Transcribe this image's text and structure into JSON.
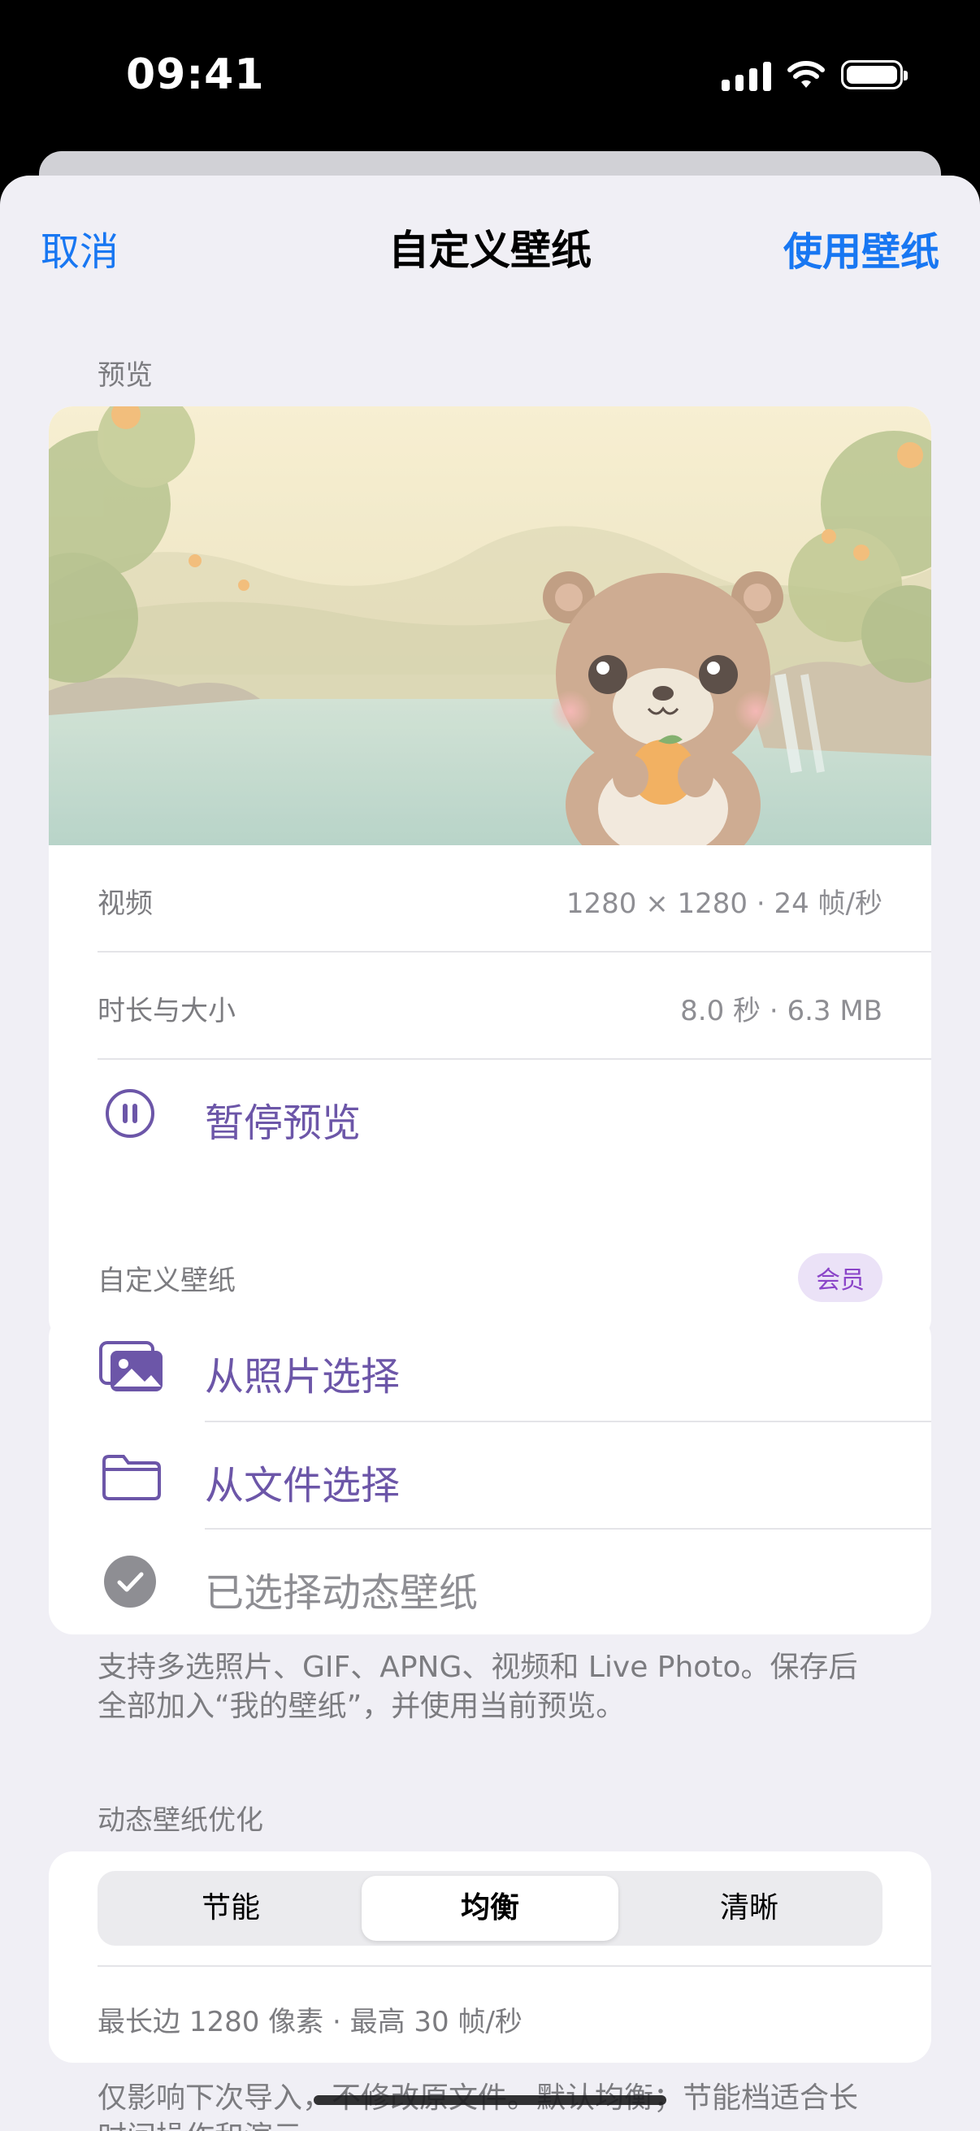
{
  "status_bar": {
    "time": "09:41"
  },
  "nav": {
    "cancel": "取消",
    "title": "自定义壁纸",
    "use": "使用壁纸"
  },
  "preview_section": {
    "label": "预览",
    "video_label": "视频",
    "video_value": "1280 × 1280 · 24 帧/秒",
    "duration_label": "时长与大小",
    "duration_value": "8.0 秒 · 6.3 MB",
    "pause_label": "暂停预览"
  },
  "custom_section": {
    "label": "自定义壁纸",
    "badge": "会员",
    "from_photos": "从照片选择",
    "from_files": "从文件选择",
    "selected": "已选择动态壁纸",
    "footnote": "支持多选照片、GIF、APNG、视频和 Live Photo。保存后全部加入“我的壁纸”，并使用当前预览。"
  },
  "optimize_section": {
    "label": "动态壁纸优化",
    "options": [
      "节能",
      "均衡",
      "清晰"
    ],
    "selected": "均衡",
    "info": "最长边 1280 像素 · 最高 30 帧/秒",
    "footnote": "仅影响下次导入，不修改原文件。默认均衡；节能档适合长时间操作和演示。"
  },
  "colors": {
    "accent_blue": "#1877f2",
    "accent_purple": "#6c56a8",
    "badge_bg": "#ebe2f7",
    "sheet_bg": "#f0eff5"
  },
  "icons": [
    "pause-circle-icon",
    "photos-icon",
    "folder-icon",
    "checkmark-circle-icon"
  ]
}
